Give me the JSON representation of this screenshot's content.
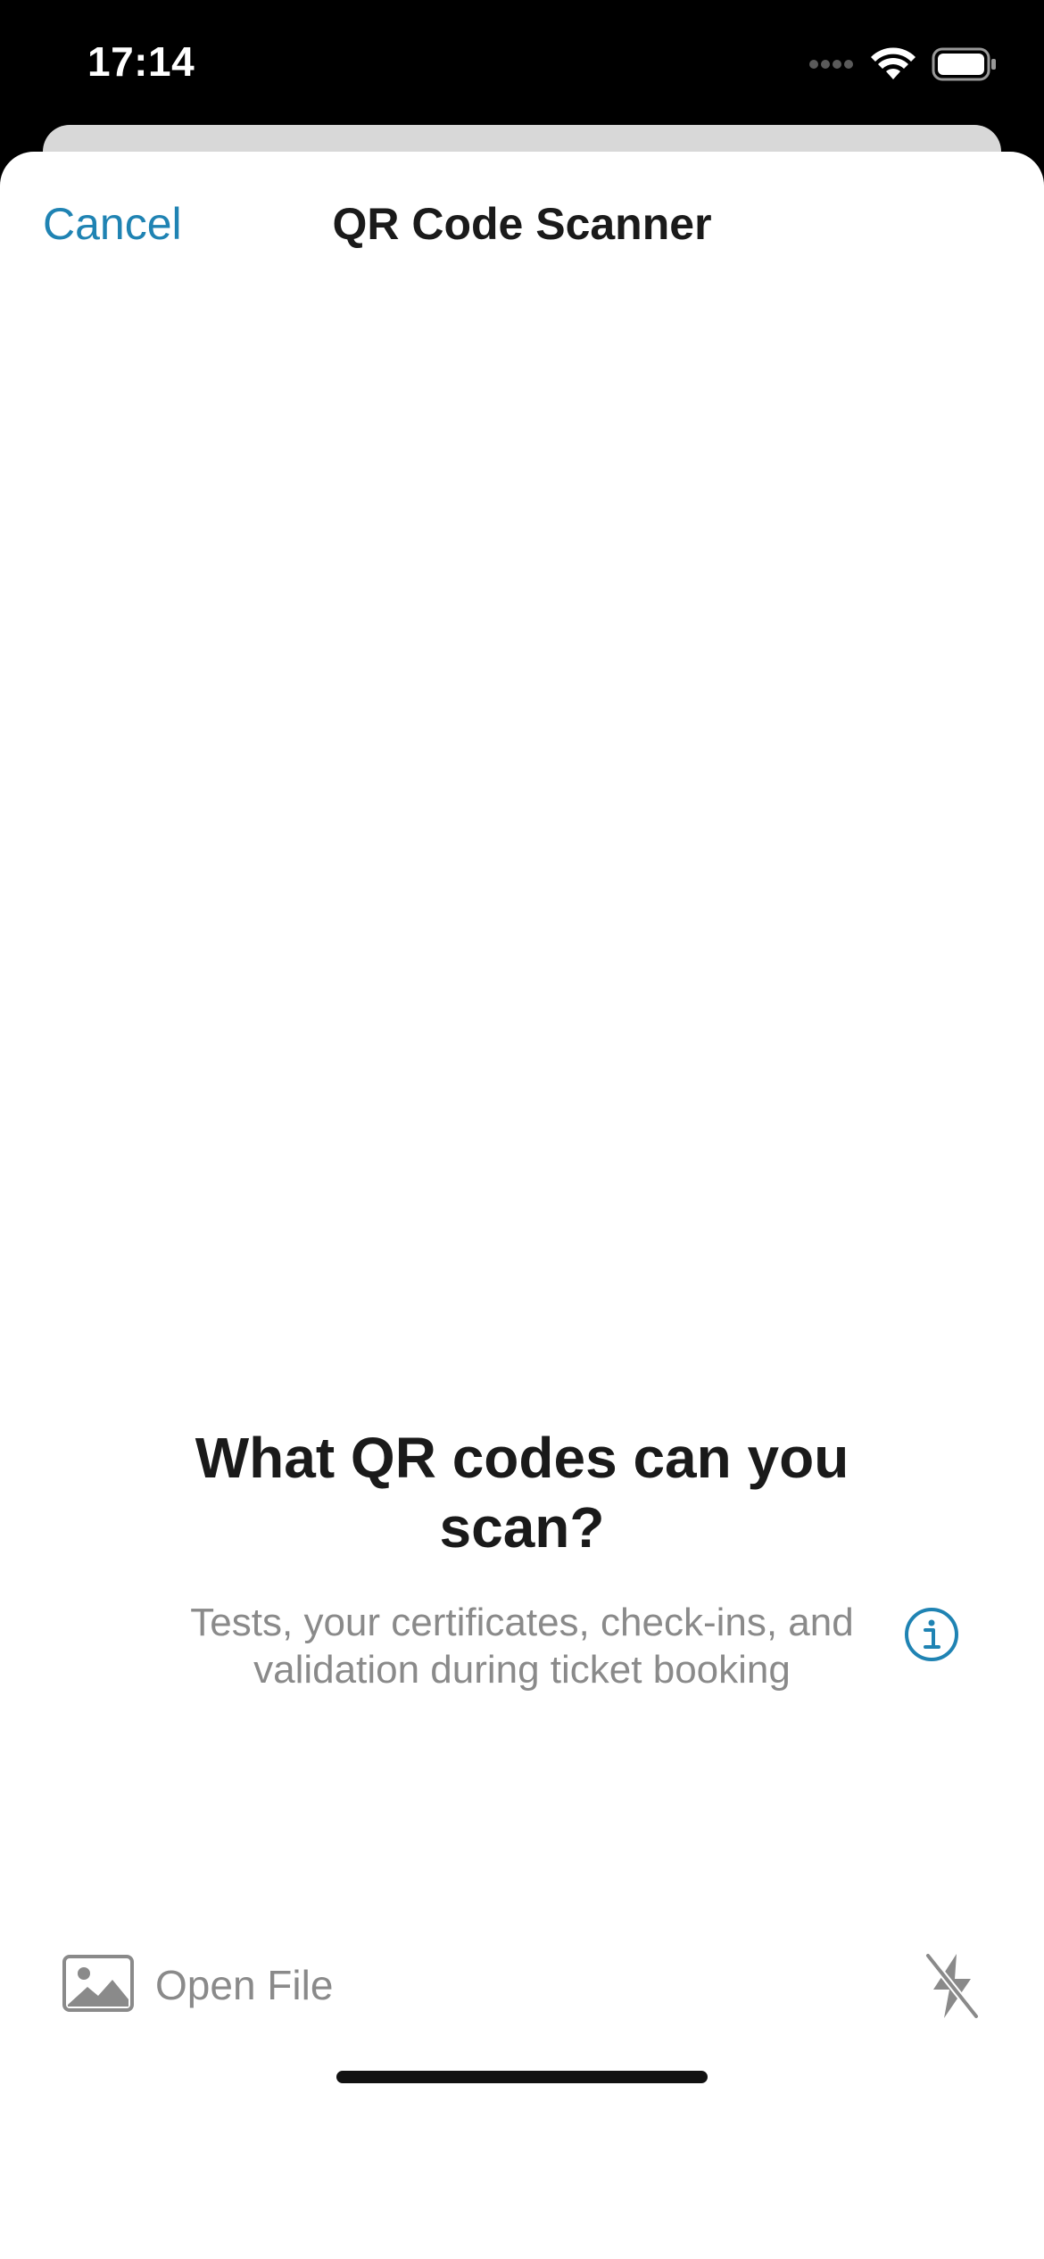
{
  "status_bar": {
    "time": "17:14",
    "icons": [
      "cellular-signal-icon",
      "wifi-icon",
      "battery-icon"
    ]
  },
  "nav": {
    "cancel_label": "Cancel",
    "title": "QR Code Scanner"
  },
  "content": {
    "heading": "What QR codes can you scan?",
    "description": "Tests, your certificates, check-ins, and validation during ticket booking",
    "info_icon": "info-circle-icon"
  },
  "bottom_bar": {
    "open_file_label": "Open File",
    "open_file_icon": "photo-icon",
    "flash_icon": "flash-off-icon"
  },
  "colors": {
    "accent": "#1f83b3",
    "secondary_text": "#8a8a8a",
    "primary_text": "#1a1a1a"
  }
}
